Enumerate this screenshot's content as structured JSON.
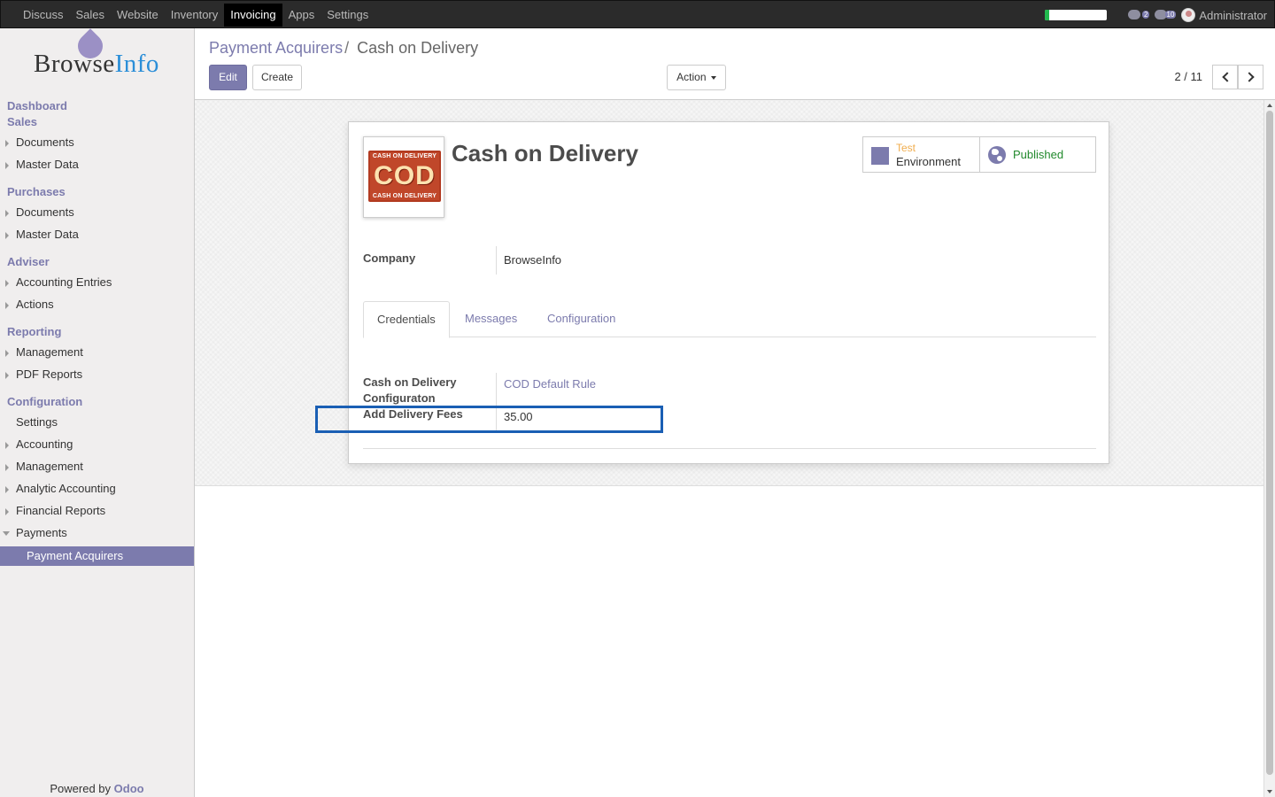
{
  "topbar": {
    "menu": [
      "Discuss",
      "Sales",
      "Website",
      "Inventory",
      "Invoicing",
      "Apps",
      "Settings"
    ],
    "active_index": 4,
    "progress_fraction": 0.07,
    "chat_count": "2",
    "message_count": "10",
    "user_name": "Administrator"
  },
  "sidebar": {
    "logo_text_a": "Browse",
    "logo_text_b": "Info",
    "dashboard": "Dashboard",
    "sales": "Sales",
    "sales_documents": "Documents",
    "sales_master_data": "Master Data",
    "purchases": "Purchases",
    "purchases_documents": "Documents",
    "purchases_master_data": "Master Data",
    "adviser": "Adviser",
    "accounting_entries": "Accounting Entries",
    "actions": "Actions",
    "reporting": "Reporting",
    "reporting_management": "Management",
    "pdf_reports": "PDF Reports",
    "configuration": "Configuration",
    "settings": "Settings",
    "accounting": "Accounting",
    "config_management": "Management",
    "analytic_accounting": "Analytic Accounting",
    "financial_reports": "Financial Reports",
    "payments": "Payments",
    "payment_acquirers": "Payment Acquirers",
    "powered_by": "Powered by",
    "odoo": "Odoo"
  },
  "controlpanel": {
    "breadcrumb_parent": "Payment Acquirers",
    "breadcrumb_sep": "/",
    "breadcrumb_current": "Cash on Delivery",
    "edit_label": "Edit",
    "create_label": "Create",
    "action_label": "Action",
    "pager": "2 / 11"
  },
  "form": {
    "image_text_top": "CASH ON DELIVERY",
    "image_text_main": "COD",
    "image_text_bottom": "CASH ON DELIVERY",
    "title": "Cash on Delivery",
    "env_label_top": "Test",
    "env_label_bottom": "Environment",
    "published_label": "Published",
    "company_label": "Company",
    "company_value": "BrowseInfo",
    "tabs": [
      "Credentials",
      "Messages",
      "Configuration"
    ],
    "cod_config_label_line1": "Cash on Delivery",
    "cod_config_label_line2": "Configuraton",
    "cod_config_value": "COD Default Rule",
    "delivery_fees_label": "Add Delivery Fees",
    "delivery_fees_value": "35.00"
  },
  "colors": {
    "brand": "#7c7bad",
    "topbar": "#2b2b2b",
    "highlight": "#1a5fb4",
    "published": "#21892c",
    "test": "#f0ad4e"
  }
}
